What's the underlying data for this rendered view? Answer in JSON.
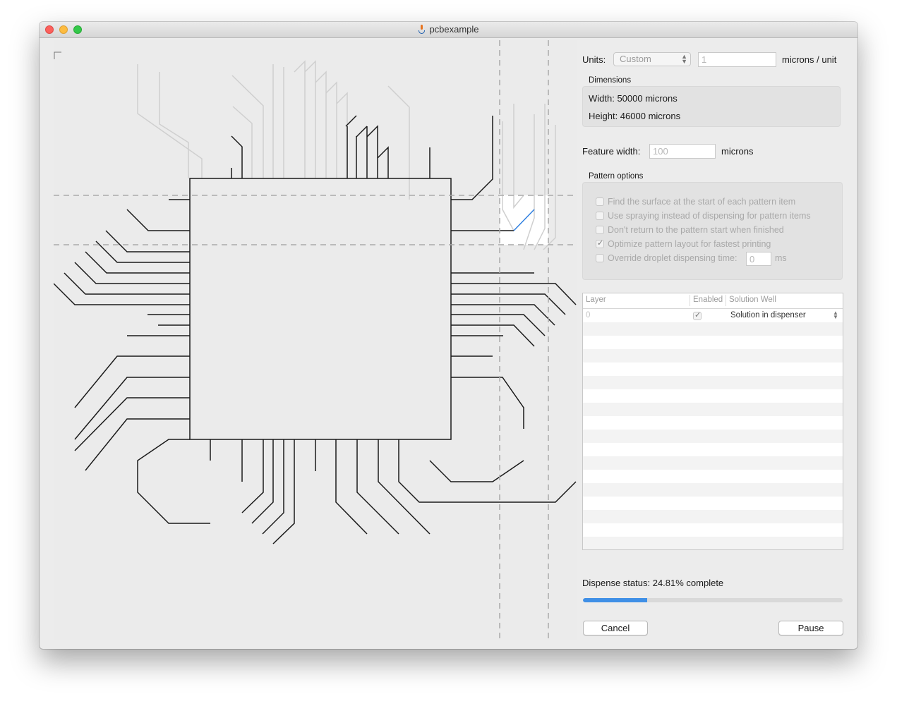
{
  "window": {
    "title": "pcbexample"
  },
  "units": {
    "label": "Units:",
    "selected": "Custom",
    "microns_per_unit_value": "1",
    "suffix": "microns / unit"
  },
  "dimensions": {
    "group_label": "Dimensions",
    "width_text": "Width: 50000 microns",
    "height_text": "Height: 46000 microns"
  },
  "feature_width": {
    "label": "Feature width:",
    "value": "100",
    "suffix": "microns"
  },
  "pattern_options": {
    "group_label": "Pattern options",
    "items": [
      {
        "label": "Find the surface at the start of each pattern item",
        "checked": false
      },
      {
        "label": "Use spraying instead of dispensing for pattern items",
        "checked": false
      },
      {
        "label": "Don't return to the pattern start when finished",
        "checked": false
      },
      {
        "label": "Optimize pattern layout for fastest printing",
        "checked": true
      },
      {
        "label": "Override droplet dispensing time:",
        "checked": false
      }
    ],
    "droplet_time_value": "0",
    "droplet_time_unit": "ms"
  },
  "layers_table": {
    "columns": [
      "Layer",
      "Enabled",
      "Solution Well"
    ],
    "rows": [
      {
        "layer": "0",
        "enabled": true,
        "solution_well": "Solution in dispenser"
      }
    ]
  },
  "status": {
    "text": "Dispense status: 24.81% complete",
    "progress_percent": 24.81
  },
  "buttons": {
    "cancel": "Cancel",
    "pause": "Pause"
  },
  "colors": {
    "accent": "#3f8fe6",
    "trace_done": "#1a1a1a",
    "trace_pending": "#cfcfcf",
    "active_trace": "#2f7fe0"
  },
  "icons": [
    "java-app-icon",
    "chevron-updown-icon",
    "checkbox-icon"
  ]
}
